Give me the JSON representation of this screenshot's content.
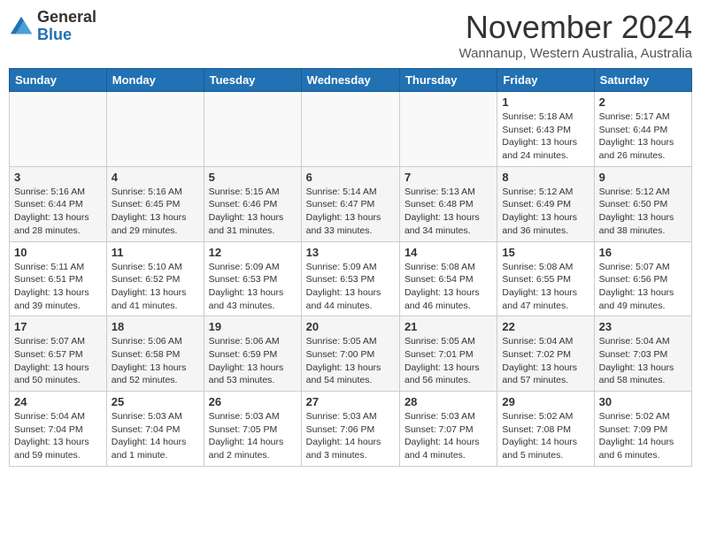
{
  "header": {
    "logo_general": "General",
    "logo_blue": "Blue",
    "month_title": "November 2024",
    "location": "Wannanup, Western Australia, Australia"
  },
  "days_of_week": [
    "Sunday",
    "Monday",
    "Tuesday",
    "Wednesday",
    "Thursday",
    "Friday",
    "Saturday"
  ],
  "weeks": [
    [
      {
        "day": "",
        "info": ""
      },
      {
        "day": "",
        "info": ""
      },
      {
        "day": "",
        "info": ""
      },
      {
        "day": "",
        "info": ""
      },
      {
        "day": "",
        "info": ""
      },
      {
        "day": "1",
        "info": "Sunrise: 5:18 AM\nSunset: 6:43 PM\nDaylight: 13 hours\nand 24 minutes."
      },
      {
        "day": "2",
        "info": "Sunrise: 5:17 AM\nSunset: 6:44 PM\nDaylight: 13 hours\nand 26 minutes."
      }
    ],
    [
      {
        "day": "3",
        "info": "Sunrise: 5:16 AM\nSunset: 6:44 PM\nDaylight: 13 hours\nand 28 minutes."
      },
      {
        "day": "4",
        "info": "Sunrise: 5:16 AM\nSunset: 6:45 PM\nDaylight: 13 hours\nand 29 minutes."
      },
      {
        "day": "5",
        "info": "Sunrise: 5:15 AM\nSunset: 6:46 PM\nDaylight: 13 hours\nand 31 minutes."
      },
      {
        "day": "6",
        "info": "Sunrise: 5:14 AM\nSunset: 6:47 PM\nDaylight: 13 hours\nand 33 minutes."
      },
      {
        "day": "7",
        "info": "Sunrise: 5:13 AM\nSunset: 6:48 PM\nDaylight: 13 hours\nand 34 minutes."
      },
      {
        "day": "8",
        "info": "Sunrise: 5:12 AM\nSunset: 6:49 PM\nDaylight: 13 hours\nand 36 minutes."
      },
      {
        "day": "9",
        "info": "Sunrise: 5:12 AM\nSunset: 6:50 PM\nDaylight: 13 hours\nand 38 minutes."
      }
    ],
    [
      {
        "day": "10",
        "info": "Sunrise: 5:11 AM\nSunset: 6:51 PM\nDaylight: 13 hours\nand 39 minutes."
      },
      {
        "day": "11",
        "info": "Sunrise: 5:10 AM\nSunset: 6:52 PM\nDaylight: 13 hours\nand 41 minutes."
      },
      {
        "day": "12",
        "info": "Sunrise: 5:09 AM\nSunset: 6:53 PM\nDaylight: 13 hours\nand 43 minutes."
      },
      {
        "day": "13",
        "info": "Sunrise: 5:09 AM\nSunset: 6:53 PM\nDaylight: 13 hours\nand 44 minutes."
      },
      {
        "day": "14",
        "info": "Sunrise: 5:08 AM\nSunset: 6:54 PM\nDaylight: 13 hours\nand 46 minutes."
      },
      {
        "day": "15",
        "info": "Sunrise: 5:08 AM\nSunset: 6:55 PM\nDaylight: 13 hours\nand 47 minutes."
      },
      {
        "day": "16",
        "info": "Sunrise: 5:07 AM\nSunset: 6:56 PM\nDaylight: 13 hours\nand 49 minutes."
      }
    ],
    [
      {
        "day": "17",
        "info": "Sunrise: 5:07 AM\nSunset: 6:57 PM\nDaylight: 13 hours\nand 50 minutes."
      },
      {
        "day": "18",
        "info": "Sunrise: 5:06 AM\nSunset: 6:58 PM\nDaylight: 13 hours\nand 52 minutes."
      },
      {
        "day": "19",
        "info": "Sunrise: 5:06 AM\nSunset: 6:59 PM\nDaylight: 13 hours\nand 53 minutes."
      },
      {
        "day": "20",
        "info": "Sunrise: 5:05 AM\nSunset: 7:00 PM\nDaylight: 13 hours\nand 54 minutes."
      },
      {
        "day": "21",
        "info": "Sunrise: 5:05 AM\nSunset: 7:01 PM\nDaylight: 13 hours\nand 56 minutes."
      },
      {
        "day": "22",
        "info": "Sunrise: 5:04 AM\nSunset: 7:02 PM\nDaylight: 13 hours\nand 57 minutes."
      },
      {
        "day": "23",
        "info": "Sunrise: 5:04 AM\nSunset: 7:03 PM\nDaylight: 13 hours\nand 58 minutes."
      }
    ],
    [
      {
        "day": "24",
        "info": "Sunrise: 5:04 AM\nSunset: 7:04 PM\nDaylight: 13 hours\nand 59 minutes."
      },
      {
        "day": "25",
        "info": "Sunrise: 5:03 AM\nSunset: 7:04 PM\nDaylight: 14 hours\nand 1 minute."
      },
      {
        "day": "26",
        "info": "Sunrise: 5:03 AM\nSunset: 7:05 PM\nDaylight: 14 hours\nand 2 minutes."
      },
      {
        "day": "27",
        "info": "Sunrise: 5:03 AM\nSunset: 7:06 PM\nDaylight: 14 hours\nand 3 minutes."
      },
      {
        "day": "28",
        "info": "Sunrise: 5:03 AM\nSunset: 7:07 PM\nDaylight: 14 hours\nand 4 minutes."
      },
      {
        "day": "29",
        "info": "Sunrise: 5:02 AM\nSunset: 7:08 PM\nDaylight: 14 hours\nand 5 minutes."
      },
      {
        "day": "30",
        "info": "Sunrise: 5:02 AM\nSunset: 7:09 PM\nDaylight: 14 hours\nand 6 minutes."
      }
    ]
  ]
}
